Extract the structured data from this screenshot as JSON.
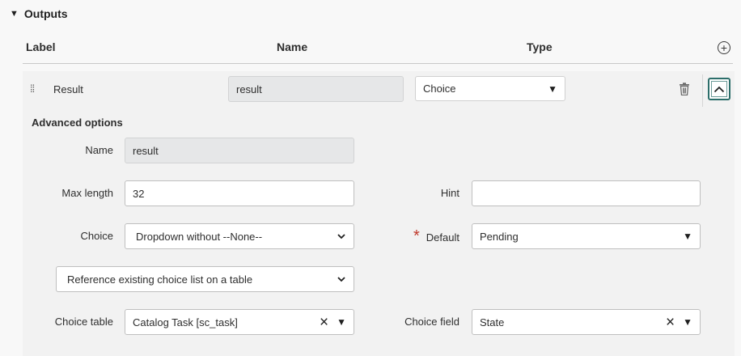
{
  "section": {
    "title": "Outputs"
  },
  "table_header": {
    "label": "Label",
    "name": "Name",
    "type": "Type"
  },
  "row": {
    "label": "Result",
    "name_value": "result",
    "type_value": "Choice"
  },
  "advanced": {
    "title": "Advanced options",
    "name_label": "Name",
    "name_value": "result",
    "max_length_label": "Max length",
    "max_length_value": "32",
    "hint_label": "Hint",
    "hint_value": "",
    "choice_label": "Choice",
    "choice_value": "Dropdown without --None--",
    "default_label": "Default",
    "default_value": "Pending",
    "choice_source_value": "Reference existing choice list on a table",
    "choice_table_label": "Choice table",
    "choice_table_value": "Catalog Task [sc_task]",
    "choice_field_label": "Choice field",
    "choice_field_value": "State"
  },
  "icons": {
    "collapse": "chevron-up-icon",
    "add": "plus-circle-icon",
    "delete": "trash-icon",
    "drag": "drag-handle-icon"
  },
  "colors": {
    "accent": "#2c6e6a",
    "required": "#c0392b"
  }
}
